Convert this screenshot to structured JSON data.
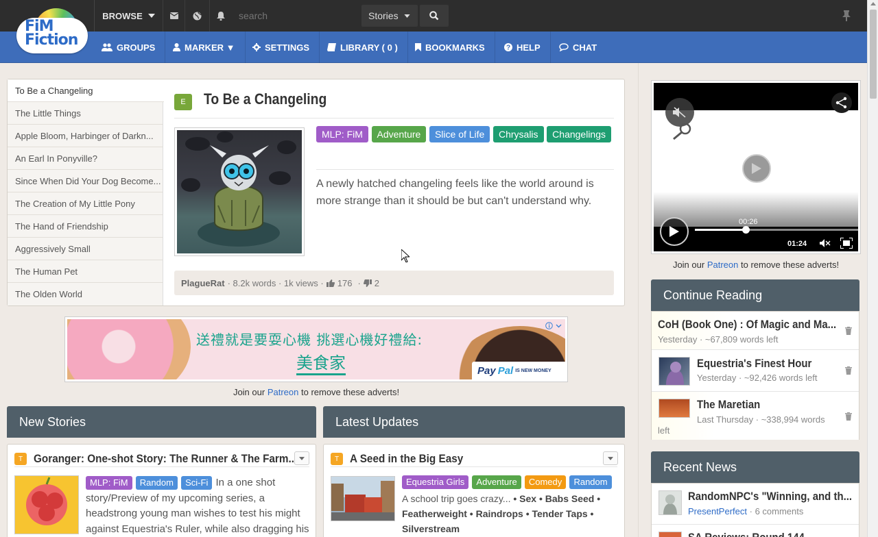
{
  "topbar": {
    "browse_label": "BROWSE",
    "search_placeholder": "search",
    "search_scope": "Stories",
    "logo_line1": "FiM",
    "logo_line2": "Fiction"
  },
  "nav": [
    {
      "label": "GROUPS",
      "icon": "users-icon"
    },
    {
      "label": "MARKER ▼",
      "icon": "user-icon"
    },
    {
      "label": "SETTINGS",
      "icon": "gear-icon"
    },
    {
      "label": "LIBRARY ( 0 )",
      "icon": "book-icon"
    },
    {
      "label": "BOOKMARKS",
      "icon": "bookmark-icon"
    },
    {
      "label": "HELP",
      "icon": "question-icon"
    },
    {
      "label": "CHAT",
      "icon": "chat-icon"
    }
  ],
  "featured": {
    "list": [
      "To Be a Changeling",
      "The Little Things",
      "Apple Bloom, Harbinger of Darkn...",
      "An Earl In Ponyville?",
      "Since When Did Your Dog Become...",
      "The Creation of My Little Pony",
      "The Hand of Friendship",
      "Aggressively Small",
      "The Human Pet",
      "The Olden World"
    ],
    "rating": "E",
    "title": "To Be a Changeling",
    "tags": [
      {
        "label": "MLP: FiM",
        "color": "#a05cc8"
      },
      {
        "label": "Adventure",
        "color": "#57a64a"
      },
      {
        "label": "Slice of Life",
        "color": "#4d8fdb"
      },
      {
        "label": "Chrysalis",
        "color": "#1e9e71"
      },
      {
        "label": "Changelings",
        "color": "#1e9e71"
      }
    ],
    "description": "A newly hatched changeling feels like the world around is more strange than it should be but can't understand why.",
    "author": "PlagueRat",
    "words": "· 8.2k words · 1k views ·",
    "likes": "176",
    "dislikes": "2",
    "stat_sep": "·"
  },
  "ad": {
    "line1": "送禮就是要耍心機  挑選心機好禮給:",
    "line2": "美食家",
    "paypal_a": "Pay",
    "paypal_b": "Pal",
    "paypal_c": "IS NEW MONEY"
  },
  "patreon": {
    "prefix": "Join our",
    "link": "Patreon",
    "suffix": "to remove these adverts!"
  },
  "new_stories": {
    "heading": "New Stories",
    "rating": "T",
    "title": "Goranger: One-shot Story: The Runner & The Farm...",
    "tags": [
      {
        "label": "MLP: FiM",
        "color": "#a05cc8"
      },
      {
        "label": "Random",
        "color": "#4d8fdb"
      },
      {
        "label": "Sci-Fi",
        "color": "#4d8fdb"
      }
    ],
    "description": "In a one shot story/Preview of my upcoming series, a headstrong young man wishes to test his might against Equestria's Ruler, while also dragging his"
  },
  "latest_updates": {
    "heading": "Latest Updates",
    "rating": "T",
    "title": "A Seed in the Big Easy",
    "tags": [
      {
        "label": "Equestria Girls",
        "color": "#a05cc8"
      },
      {
        "label": "Adventure",
        "color": "#57a64a"
      },
      {
        "label": "Comedy",
        "color": "#f39a12"
      },
      {
        "label": "Random",
        "color": "#4d8fdb"
      }
    ],
    "description": "A school trip goes crazy...",
    "characters_line1": "• Sex • Babs Seed •",
    "characters_line2": "Featherweight • Raindrops • Tender Taps •",
    "characters_line3": "Silverstream"
  },
  "video": {
    "current_time": "00:26",
    "duration": "01:24",
    "progress_fraction": 0.31
  },
  "continue_reading": {
    "heading": "Continue Reading",
    "items": [
      {
        "title": "CoH (Book One) : Of Magic and Ma...",
        "meta": "Yesterday · ~67,809 words left"
      },
      {
        "title": "Equestria's Finest Hour",
        "meta": "Yesterday · ~92,426 words left"
      },
      {
        "title": "The Maretian",
        "meta": "Last Thursday · ~338,994 words",
        "meta2": "left"
      }
    ]
  },
  "recent_news": {
    "heading": "Recent News",
    "items": [
      {
        "title": "RandomNPC's \"Winning, and th...",
        "author": "PresentPerfect",
        "meta": "· 6 comments"
      },
      {
        "title": "SA Reviews: Round 144"
      }
    ]
  }
}
